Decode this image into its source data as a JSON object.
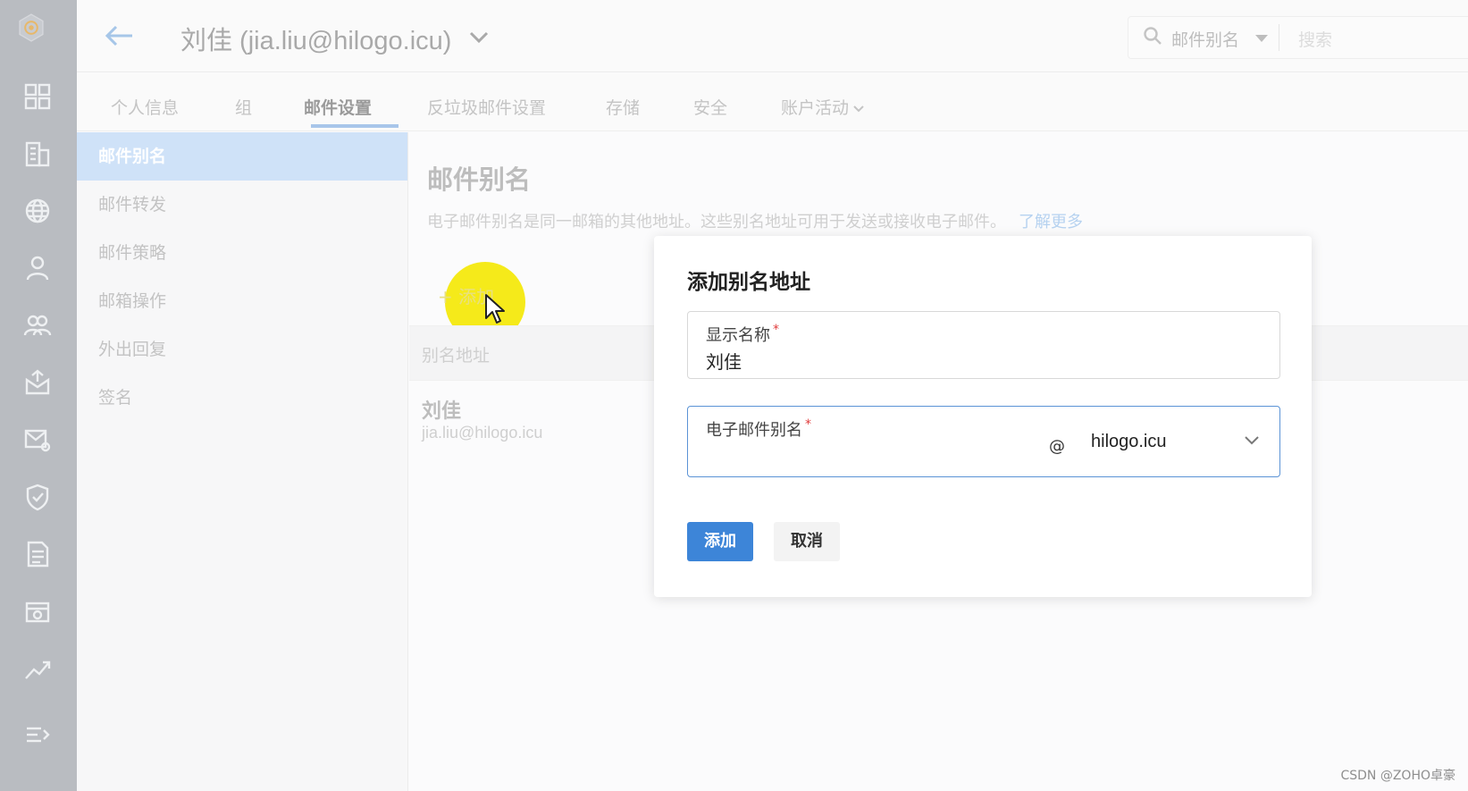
{
  "header": {
    "title": "刘佳 (jia.liu@hilogo.icu)",
    "search_scope": "邮件别名",
    "search_placeholder": "搜索"
  },
  "tabs": [
    {
      "label": "个人信息"
    },
    {
      "label": "组"
    },
    {
      "label": "邮件设置",
      "active": true
    },
    {
      "label": "反垃圾邮件设置"
    },
    {
      "label": "存储"
    },
    {
      "label": "安全"
    },
    {
      "label": "账户活动",
      "has_dropdown": true
    }
  ],
  "subnav": [
    {
      "label": "邮件别名",
      "active": true
    },
    {
      "label": "邮件转发"
    },
    {
      "label": "邮件策略"
    },
    {
      "label": "邮箱操作"
    },
    {
      "label": "外出回复"
    },
    {
      "label": "签名"
    }
  ],
  "content": {
    "heading": "邮件别名",
    "description": "电子邮件别名是同一邮箱的其他地址。这些别名地址可用于发送或接收电子邮件。",
    "learn_more": "了解更多",
    "add_button": "+ 添加",
    "table_header": "别名地址",
    "row_name": "刘佳",
    "row_email": "jia.liu@hilogo.icu"
  },
  "dialog": {
    "title": "添加别名地址",
    "display_name_label": "显示名称",
    "display_name_value": "刘佳",
    "alias_label": "电子邮件别名",
    "at_symbol": "@",
    "domain": "hilogo.icu",
    "add_button": "添加",
    "cancel_button": "取消"
  },
  "rail_icons": [
    "logo-icon",
    "dashboard-icon",
    "organization-icon",
    "domains-icon",
    "user-icon",
    "groups-icon",
    "inbox-icon",
    "mail-settings-icon",
    "security-icon",
    "reports-icon",
    "storage-icon",
    "analytics-icon",
    "collapse-menu-icon"
  ],
  "colors": {
    "accent": "#3d85d8",
    "rail_bg": "#b9bcc1",
    "highlight": "#f5ea1a"
  },
  "watermark": "CSDN @ZOHO卓豪"
}
